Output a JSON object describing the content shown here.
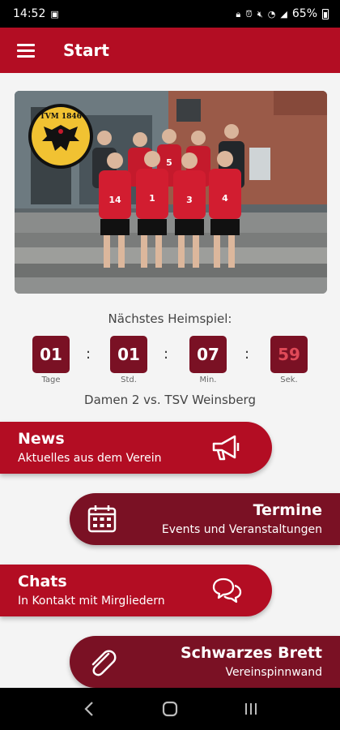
{
  "status_bar": {
    "time": "14:52",
    "battery": "65%"
  },
  "app_bar": {
    "title": "Start"
  },
  "photo": {
    "logo_text": "TVM 1846",
    "jersey_numbers": [
      "14",
      "1",
      "3",
      "4",
      "5"
    ]
  },
  "countdown": {
    "label": "Nächstes Heimspiel:",
    "days": "01",
    "days_label": "Tage",
    "hours": "01",
    "hours_label": "Std.",
    "minutes": "07",
    "minutes_label": "Min.",
    "seconds": "59",
    "seconds_label": "Sek.",
    "separator": ":",
    "match": "Damen 2 vs. TSV Weinsberg"
  },
  "cards": [
    {
      "title": "News",
      "subtitle": "Aktuelles aus dem Verein",
      "icon": "megaphone-icon"
    },
    {
      "title": "Termine",
      "subtitle": "Events und Veranstaltungen",
      "icon": "calendar-icon"
    },
    {
      "title": "Chats",
      "subtitle": "In Kontakt mit Mirgliedern",
      "icon": "chat-bubbles-icon"
    },
    {
      "title": "Schwarzes Brett",
      "subtitle": "Vereinspinnwand",
      "icon": "paperclip-icon"
    }
  ],
  "colors": {
    "primary": "#b30d23",
    "secondary": "#7a1124"
  }
}
